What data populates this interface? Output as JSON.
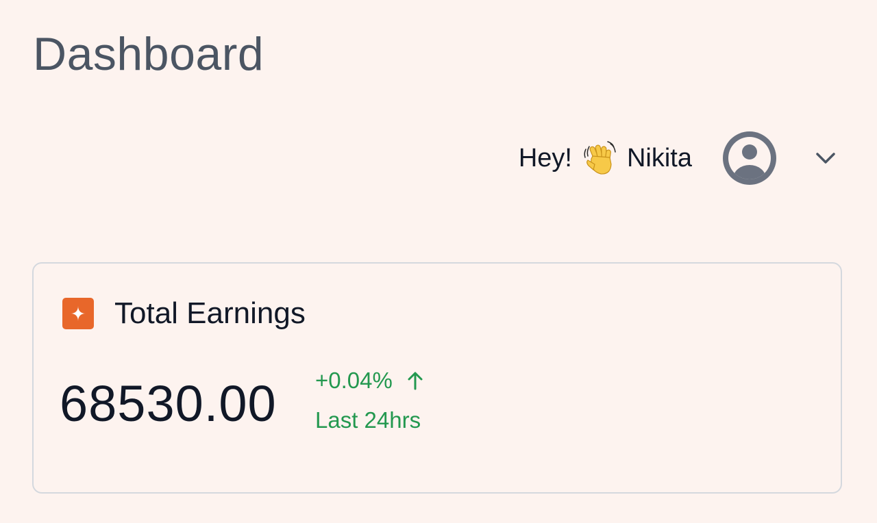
{
  "header": {
    "title": "Dashboard"
  },
  "user": {
    "greeting_prefix": "Hey!",
    "greeting_emoji": "waving-hand-icon",
    "name": "Nikita",
    "avatar_icon": "user-avatar-icon",
    "menu_icon": "chevron-down-icon"
  },
  "earnings_card": {
    "icon": "sparkle-icon",
    "title": "Total Earnings",
    "value": "68530.00",
    "change": "+0.04%",
    "change_icon": "arrow-up-icon",
    "period": "Last 24hrs"
  },
  "colors": {
    "background": "#fdf3ef",
    "title": "#4b5563",
    "accent": "#e8672a",
    "positive": "#23984f",
    "card_border": "#d4d8de"
  }
}
